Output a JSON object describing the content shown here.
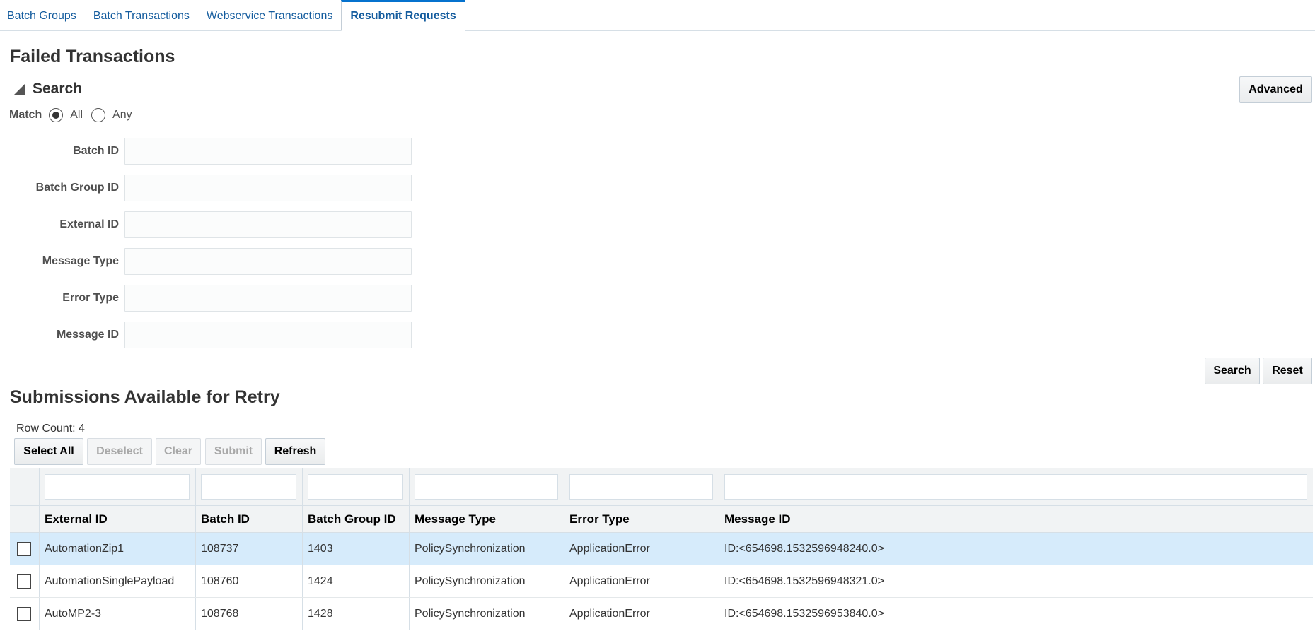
{
  "tabs": [
    {
      "label": "Batch Groups"
    },
    {
      "label": "Batch Transactions"
    },
    {
      "label": "Webservice Transactions"
    },
    {
      "label": "Resubmit Requests"
    }
  ],
  "page_title": "Failed Transactions",
  "search": {
    "title": "Search",
    "advanced_label": "Advanced",
    "match_label": "Match",
    "match_all": "All",
    "match_any": "Any",
    "fields": [
      {
        "label": "Batch ID",
        "value": ""
      },
      {
        "label": "Batch Group ID",
        "value": ""
      },
      {
        "label": "External ID",
        "value": ""
      },
      {
        "label": "Message Type",
        "value": ""
      },
      {
        "label": "Error Type",
        "value": ""
      },
      {
        "label": "Message ID",
        "value": ""
      }
    ],
    "search_button": "Search",
    "reset_button": "Reset"
  },
  "section_title": "Submissions Available for Retry",
  "row_count": "Row Count: 4",
  "toolbar": {
    "select_all": "Select All",
    "deselect": "Deselect",
    "clear": "Clear",
    "submit": "Submit",
    "refresh": "Refresh"
  },
  "table": {
    "headers": [
      "External ID",
      "Batch ID",
      "Batch Group ID",
      "Message Type",
      "Error Type",
      "Message ID"
    ],
    "rows": [
      [
        "AutomationZip1",
        "108737",
        "1403",
        "PolicySynchronization",
        "ApplicationError",
        "ID:<654698.1532596948240.0>"
      ],
      [
        "AutomationSinglePayload",
        "108760",
        "1424",
        "PolicySynchronization",
        "ApplicationError",
        "ID:<654698.1532596948321.0>"
      ],
      [
        "AutoMP2-3",
        "108768",
        "1428",
        "PolicySynchronization",
        "ApplicationError",
        "ID:<654698.1532596953840.0>"
      ]
    ]
  },
  "colors": {
    "tab_text": "#145c9e",
    "tab_active_border": "#0572ce",
    "selected_row": "#d6ebfb"
  }
}
